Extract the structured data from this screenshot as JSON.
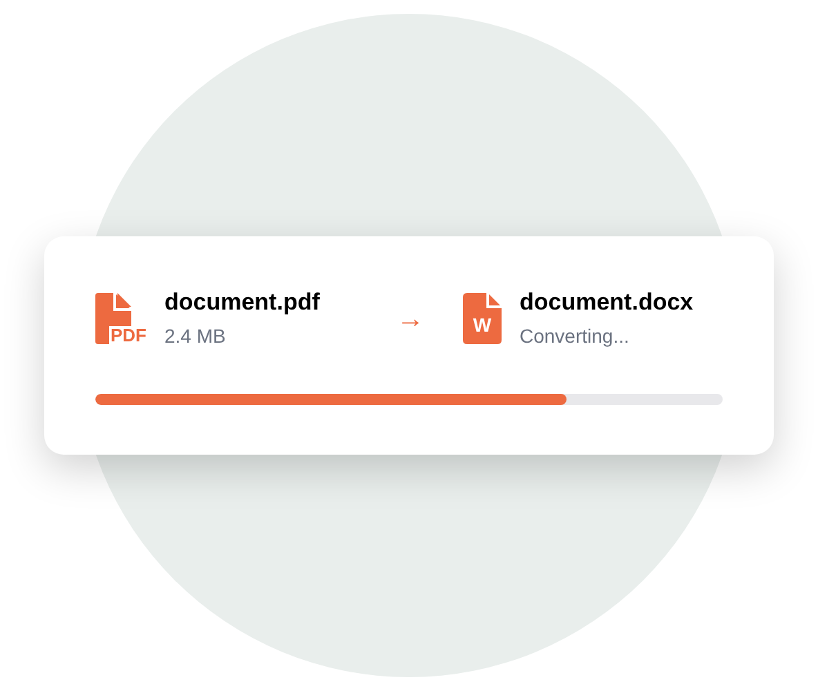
{
  "source": {
    "icon_label": "PDF",
    "name": "document.pdf",
    "detail": "2.4 MB"
  },
  "arrow": "→",
  "target": {
    "icon_label": "W",
    "name": "document.docx",
    "detail": "Converting..."
  },
  "progress": {
    "level": 0.75
  }
}
